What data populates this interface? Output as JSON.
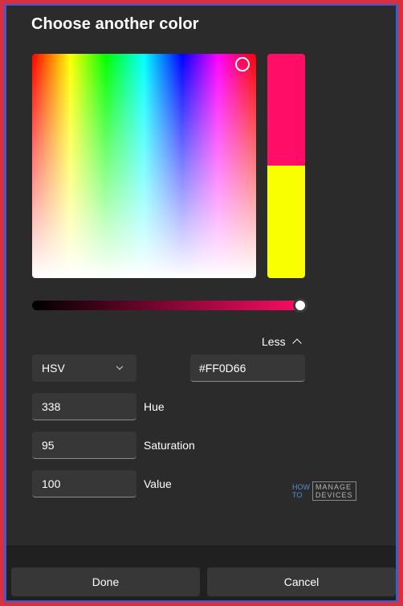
{
  "dialog": {
    "title": "Choose another color"
  },
  "colors": {
    "new": "#FF0D66",
    "old": "#F9FF00"
  },
  "value_slider": {
    "value": 100,
    "max": 100
  },
  "toggle": {
    "label": "Less"
  },
  "model_select": {
    "selected": "HSV"
  },
  "hex": {
    "value": "#FF0D66"
  },
  "fields": [
    {
      "value": "338",
      "label": "Hue"
    },
    {
      "value": "95",
      "label": "Saturation"
    },
    {
      "value": "100",
      "label": "Value"
    }
  ],
  "watermark": {
    "line1": "HOW",
    "line2": "TO",
    "line3": "MANAGE",
    "line4": "DEVICES"
  },
  "footer": {
    "done_label": "Done",
    "cancel_label": "Cancel"
  }
}
